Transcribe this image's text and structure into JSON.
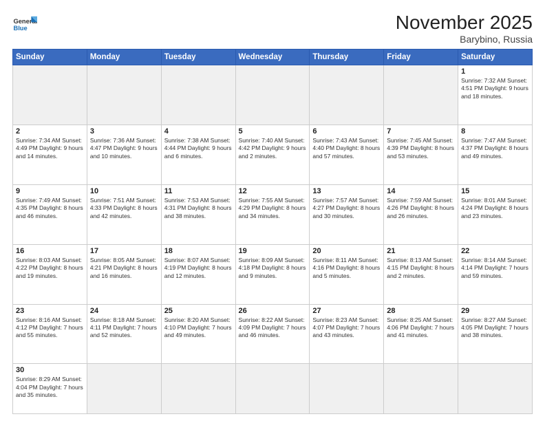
{
  "header": {
    "logo_general": "General",
    "logo_blue": "Blue",
    "title": "November 2025",
    "location": "Barybino, Russia"
  },
  "weekdays": [
    "Sunday",
    "Monday",
    "Tuesday",
    "Wednesday",
    "Thursday",
    "Friday",
    "Saturday"
  ],
  "weeks": [
    [
      {
        "day": "",
        "info": ""
      },
      {
        "day": "",
        "info": ""
      },
      {
        "day": "",
        "info": ""
      },
      {
        "day": "",
        "info": ""
      },
      {
        "day": "",
        "info": ""
      },
      {
        "day": "",
        "info": ""
      },
      {
        "day": "1",
        "info": "Sunrise: 7:32 AM\nSunset: 4:51 PM\nDaylight: 9 hours\nand 18 minutes."
      }
    ],
    [
      {
        "day": "2",
        "info": "Sunrise: 7:34 AM\nSunset: 4:49 PM\nDaylight: 9 hours\nand 14 minutes."
      },
      {
        "day": "3",
        "info": "Sunrise: 7:36 AM\nSunset: 4:47 PM\nDaylight: 9 hours\nand 10 minutes."
      },
      {
        "day": "4",
        "info": "Sunrise: 7:38 AM\nSunset: 4:44 PM\nDaylight: 9 hours\nand 6 minutes."
      },
      {
        "day": "5",
        "info": "Sunrise: 7:40 AM\nSunset: 4:42 PM\nDaylight: 9 hours\nand 2 minutes."
      },
      {
        "day": "6",
        "info": "Sunrise: 7:43 AM\nSunset: 4:40 PM\nDaylight: 8 hours\nand 57 minutes."
      },
      {
        "day": "7",
        "info": "Sunrise: 7:45 AM\nSunset: 4:39 PM\nDaylight: 8 hours\nand 53 minutes."
      },
      {
        "day": "8",
        "info": "Sunrise: 7:47 AM\nSunset: 4:37 PM\nDaylight: 8 hours\nand 49 minutes."
      }
    ],
    [
      {
        "day": "9",
        "info": "Sunrise: 7:49 AM\nSunset: 4:35 PM\nDaylight: 8 hours\nand 46 minutes."
      },
      {
        "day": "10",
        "info": "Sunrise: 7:51 AM\nSunset: 4:33 PM\nDaylight: 8 hours\nand 42 minutes."
      },
      {
        "day": "11",
        "info": "Sunrise: 7:53 AM\nSunset: 4:31 PM\nDaylight: 8 hours\nand 38 minutes."
      },
      {
        "day": "12",
        "info": "Sunrise: 7:55 AM\nSunset: 4:29 PM\nDaylight: 8 hours\nand 34 minutes."
      },
      {
        "day": "13",
        "info": "Sunrise: 7:57 AM\nSunset: 4:27 PM\nDaylight: 8 hours\nand 30 minutes."
      },
      {
        "day": "14",
        "info": "Sunrise: 7:59 AM\nSunset: 4:26 PM\nDaylight: 8 hours\nand 26 minutes."
      },
      {
        "day": "15",
        "info": "Sunrise: 8:01 AM\nSunset: 4:24 PM\nDaylight: 8 hours\nand 23 minutes."
      }
    ],
    [
      {
        "day": "16",
        "info": "Sunrise: 8:03 AM\nSunset: 4:22 PM\nDaylight: 8 hours\nand 19 minutes."
      },
      {
        "day": "17",
        "info": "Sunrise: 8:05 AM\nSunset: 4:21 PM\nDaylight: 8 hours\nand 16 minutes."
      },
      {
        "day": "18",
        "info": "Sunrise: 8:07 AM\nSunset: 4:19 PM\nDaylight: 8 hours\nand 12 minutes."
      },
      {
        "day": "19",
        "info": "Sunrise: 8:09 AM\nSunset: 4:18 PM\nDaylight: 8 hours\nand 9 minutes."
      },
      {
        "day": "20",
        "info": "Sunrise: 8:11 AM\nSunset: 4:16 PM\nDaylight: 8 hours\nand 5 minutes."
      },
      {
        "day": "21",
        "info": "Sunrise: 8:13 AM\nSunset: 4:15 PM\nDaylight: 8 hours\nand 2 minutes."
      },
      {
        "day": "22",
        "info": "Sunrise: 8:14 AM\nSunset: 4:14 PM\nDaylight: 7 hours\nand 59 minutes."
      }
    ],
    [
      {
        "day": "23",
        "info": "Sunrise: 8:16 AM\nSunset: 4:12 PM\nDaylight: 7 hours\nand 55 minutes."
      },
      {
        "day": "24",
        "info": "Sunrise: 8:18 AM\nSunset: 4:11 PM\nDaylight: 7 hours\nand 52 minutes."
      },
      {
        "day": "25",
        "info": "Sunrise: 8:20 AM\nSunset: 4:10 PM\nDaylight: 7 hours\nand 49 minutes."
      },
      {
        "day": "26",
        "info": "Sunrise: 8:22 AM\nSunset: 4:09 PM\nDaylight: 7 hours\nand 46 minutes."
      },
      {
        "day": "27",
        "info": "Sunrise: 8:23 AM\nSunset: 4:07 PM\nDaylight: 7 hours\nand 43 minutes."
      },
      {
        "day": "28",
        "info": "Sunrise: 8:25 AM\nSunset: 4:06 PM\nDaylight: 7 hours\nand 41 minutes."
      },
      {
        "day": "29",
        "info": "Sunrise: 8:27 AM\nSunset: 4:05 PM\nDaylight: 7 hours\nand 38 minutes."
      }
    ],
    [
      {
        "day": "30",
        "info": "Sunrise: 8:29 AM\nSunset: 4:04 PM\nDaylight: 7 hours\nand 35 minutes."
      },
      {
        "day": "",
        "info": ""
      },
      {
        "day": "",
        "info": ""
      },
      {
        "day": "",
        "info": ""
      },
      {
        "day": "",
        "info": ""
      },
      {
        "day": "",
        "info": ""
      },
      {
        "day": "",
        "info": ""
      }
    ]
  ]
}
